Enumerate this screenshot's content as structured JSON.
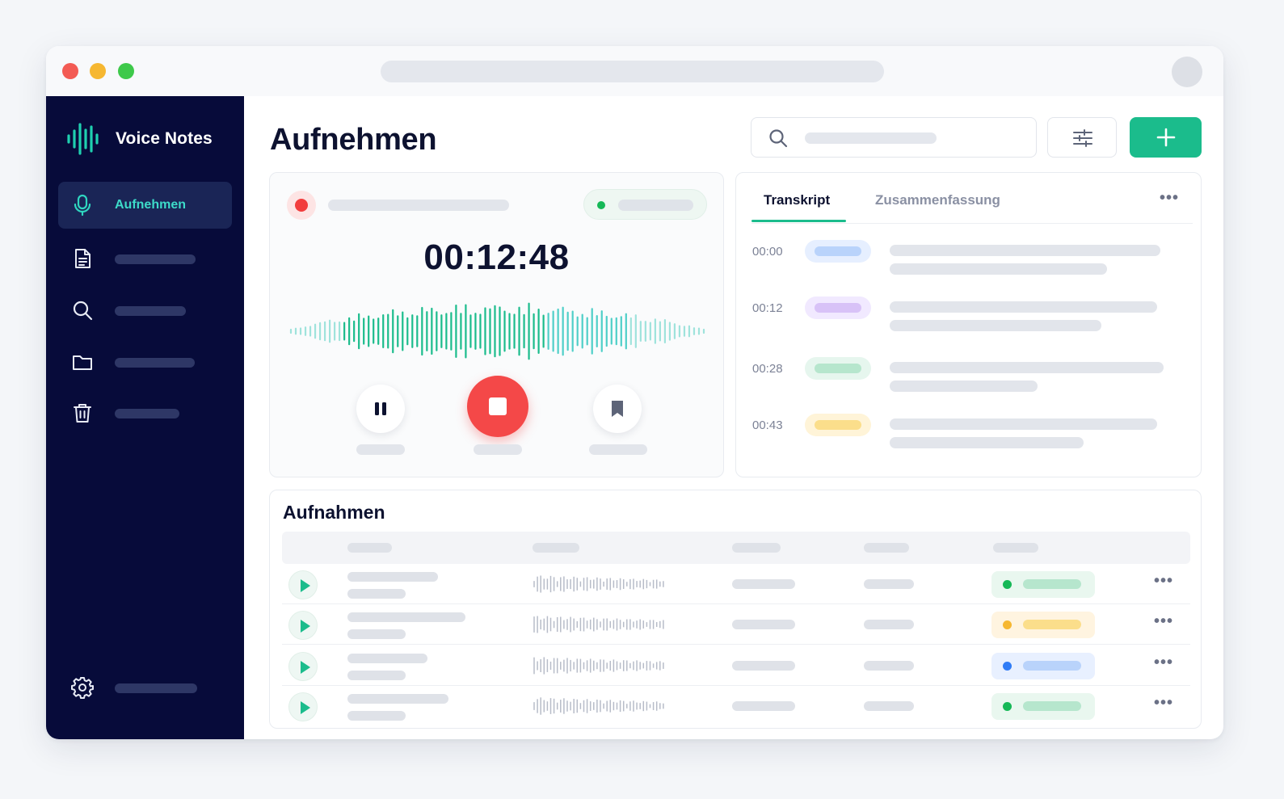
{
  "app": {
    "brand_name": "Voice Notes",
    "accent_color": "#1bbc8c",
    "sidebar_color": "#070b3a"
  },
  "sidebar": {
    "items": [
      {
        "icon": "mic-icon",
        "label": "Aufnehmen",
        "active": true
      },
      {
        "icon": "document-icon",
        "label": ""
      },
      {
        "icon": "search-icon",
        "label": ""
      },
      {
        "icon": "folder-icon",
        "label": ""
      },
      {
        "icon": "trash-icon",
        "label": ""
      }
    ],
    "settings_icon": "gear-icon"
  },
  "header": {
    "title": "Aufnehmen",
    "search_icon": "search-icon",
    "filter_icon": "sliders-icon",
    "add_icon": "plus-icon"
  },
  "recorder": {
    "timer": "00:12:48",
    "recording_color": "#f23d3d",
    "live_status_color": "#16b857",
    "controls": [
      "pause-icon",
      "stop-icon",
      "bookmark-icon"
    ]
  },
  "transcript": {
    "tabs": [
      "Transkript",
      "Zusammenfassung"
    ],
    "active_tab": "Transkript",
    "entries": [
      {
        "time": "00:00",
        "color": "#b9d3fb",
        "bg": "#e6efff"
      },
      {
        "time": "00:12",
        "color": "#d8c2f7",
        "bg": "#f1e9ff"
      },
      {
        "time": "00:28",
        "color": "#b6e6cd",
        "bg": "#e6f6ee"
      },
      {
        "time": "00:43",
        "color": "#fbde8b",
        "bg": "#fff4d8"
      }
    ]
  },
  "recordings": {
    "title": "Aufnahmen",
    "rows": [
      {
        "status_dot": "#16b857",
        "status_bar": "#b6e6cd",
        "status_bg": "#e9f7ef"
      },
      {
        "status_dot": "#f6b731",
        "status_bar": "#fbde8b",
        "status_bg": "#fff4e0"
      },
      {
        "status_dot": "#2f7cf6",
        "status_bar": "#b9d3fb",
        "status_bg": "#e8f0ff"
      },
      {
        "status_dot": "#16b857",
        "status_bar": "#b6e6cd",
        "status_bg": "#e9f7ef"
      }
    ]
  }
}
